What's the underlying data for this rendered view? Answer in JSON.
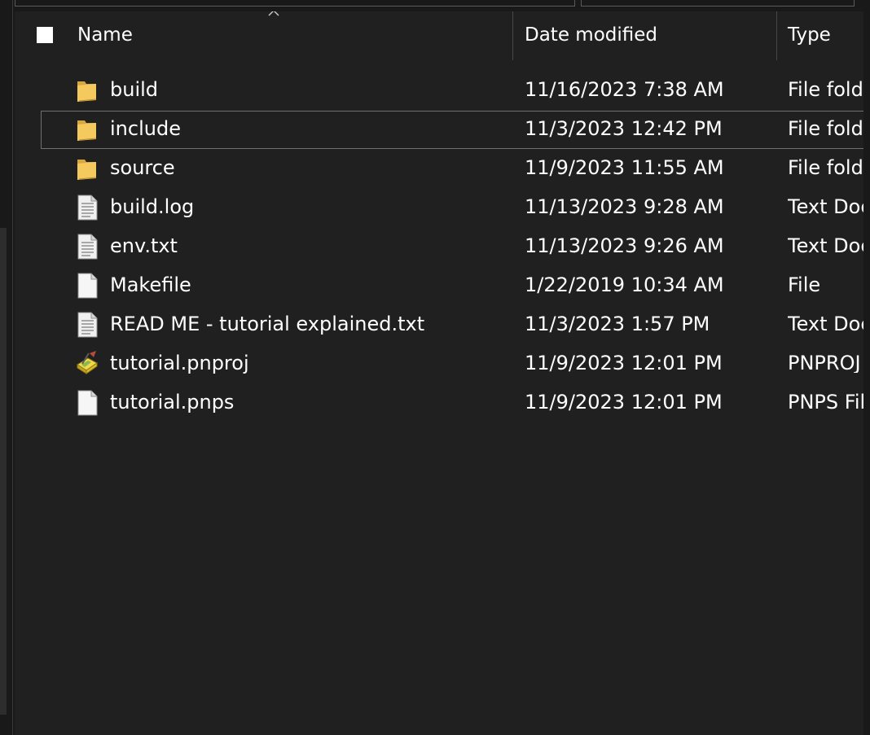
{
  "header": {
    "name_label": "Name",
    "date_label": "Date modified",
    "type_label": "Type",
    "sort_indicator": "chevron-up-icon"
  },
  "files": [
    {
      "name": "build",
      "date": "11/16/2023 7:38 AM",
      "type": "File folder",
      "icon": "folder-icon"
    },
    {
      "name": "include",
      "date": "11/3/2023 12:42 PM",
      "type": "File folder",
      "icon": "folder-icon",
      "focused": true
    },
    {
      "name": "source",
      "date": "11/9/2023 11:55 AM",
      "type": "File folder",
      "icon": "folder-icon"
    },
    {
      "name": "build.log",
      "date": "11/13/2023 9:28 AM",
      "type": "Text Document",
      "icon": "text-document-icon"
    },
    {
      "name": "env.txt",
      "date": "11/13/2023 9:26 AM",
      "type": "Text Document",
      "icon": "text-document-icon"
    },
    {
      "name": "Makefile",
      "date": "1/22/2019 10:34 AM",
      "type": "File",
      "icon": "blank-file-icon"
    },
    {
      "name": "READ ME - tutorial explained.txt",
      "date": "11/3/2023 1:57 PM",
      "type": "Text Document",
      "icon": "text-document-icon"
    },
    {
      "name": "tutorial.pnproj",
      "date": "11/9/2023 12:01 PM",
      "type": "PNPROJ File",
      "icon": "pnproj-file-icon"
    },
    {
      "name": "tutorial.pnps",
      "date": "11/9/2023 12:01 PM",
      "type": "PNPS File",
      "icon": "blank-file-icon"
    }
  ],
  "colors": {
    "background": "#202020",
    "frame": "#191919",
    "text": "#ffffff",
    "folder": "#f4c95d",
    "document": "#f0f0f0"
  }
}
